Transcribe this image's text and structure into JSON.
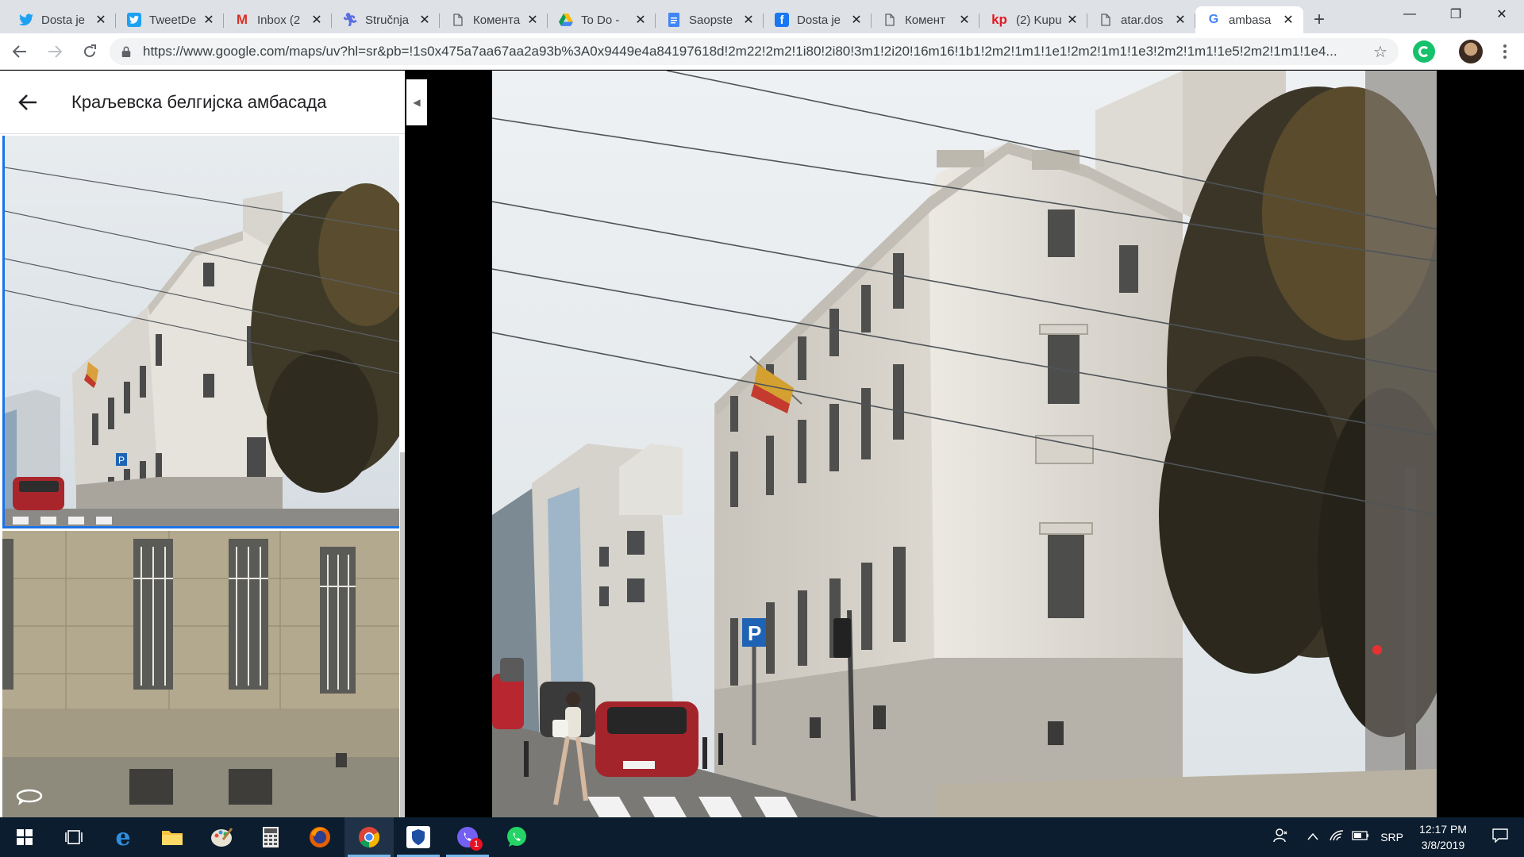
{
  "browser": {
    "tabs": [
      {
        "title": "Dosta je",
        "icon": "twitter-icon",
        "color": "#1da1f2"
      },
      {
        "title": "TweetDe",
        "icon": "tweetdeck-icon",
        "color": "#1da1f2"
      },
      {
        "title": "Inbox (2",
        "icon": "gmail-icon",
        "color": "#d93025"
      },
      {
        "title": "Stručnja",
        "icon": "person-icon",
        "color": "#5b6ee1"
      },
      {
        "title": "Коментa",
        "icon": "document-icon",
        "color": "#5f6368"
      },
      {
        "title": "To Do -",
        "icon": "google-drive-icon",
        "color": "#0f9d58"
      },
      {
        "title": "Saopste",
        "icon": "google-docs-icon",
        "color": "#4285f4"
      },
      {
        "title": "Dosta je",
        "icon": "facebook-icon",
        "color": "#1877f2"
      },
      {
        "title": "Комент",
        "icon": "document-icon",
        "color": "#5f6368"
      },
      {
        "title": "(2) Kupu",
        "icon": "kp-icon",
        "color": "#e21b22"
      },
      {
        "title": "atar.dos",
        "icon": "document-icon",
        "color": "#5f6368"
      },
      {
        "title": "ambasa",
        "icon": "google-icon",
        "color": "#4285f4",
        "active": true
      }
    ],
    "url": "https://www.google.com/maps/uv?hl=sr&pb=!1s0x475a7aa67aa2a93b%3A0x9449e4a84197618d!2m22!2m2!1i80!2i80!3m1!2i20!16m16!1b1!2m2!1m1!1e1!2m2!1m1!1e3!2m2!1m1!1e5!2m2!1m1!1e4..."
  },
  "panel": {
    "title": "Краљевска белгијска амбасада"
  },
  "taskbar": {
    "apps": [
      "start-icon",
      "task-view-icon",
      "edge-icon",
      "file-explorer-icon",
      "paint-icon",
      "calculator-icon",
      "firefox-icon",
      "chrome-icon",
      "defender-icon",
      "viber-icon",
      "whatsapp-icon"
    ],
    "viber_badge": "1",
    "language": "SRP",
    "time": "12:17 PM",
    "date": "3/8/2019"
  }
}
